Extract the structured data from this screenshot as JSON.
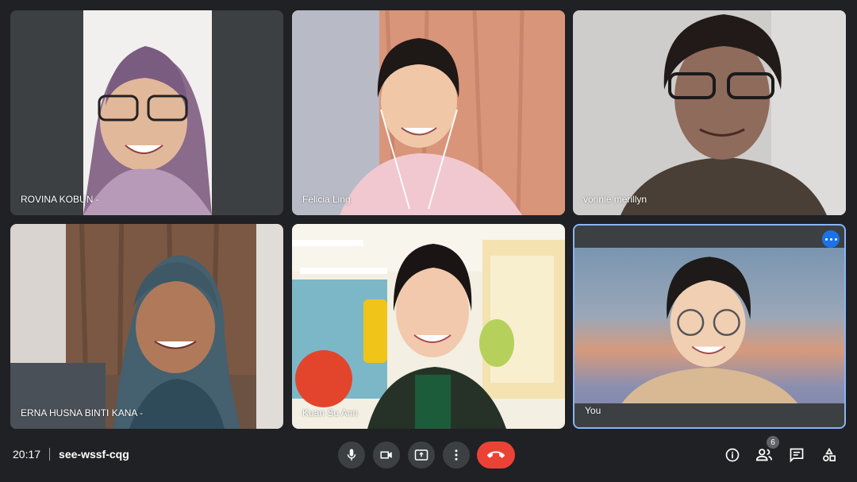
{
  "participants": [
    {
      "name": "ROVINA KOBUN -"
    },
    {
      "name": "Felicia Ling"
    },
    {
      "name": "vonnie merillyn"
    },
    {
      "name": "ERNA HUSNA BINTI KANA -"
    },
    {
      "name": "Kuan Su Ann"
    },
    {
      "name": "You"
    }
  ],
  "meeting": {
    "time": "20:17",
    "code": "see-wssf-cqg"
  },
  "people": {
    "count": "6"
  },
  "icons": {
    "more": "more-horiz-icon",
    "mic": "mic-icon",
    "camera": "camera-icon",
    "present": "present-screen-icon",
    "options": "more-vert-icon",
    "end": "call-end-icon",
    "info": "info-icon",
    "people": "people-icon",
    "chat": "chat-icon",
    "activities": "activities-icon"
  },
  "colors": {
    "background": "#202124",
    "control": "#3c4043",
    "end_call": "#ea4335",
    "self_border": "#8ab4f8",
    "more_button": "#1a73e8"
  }
}
